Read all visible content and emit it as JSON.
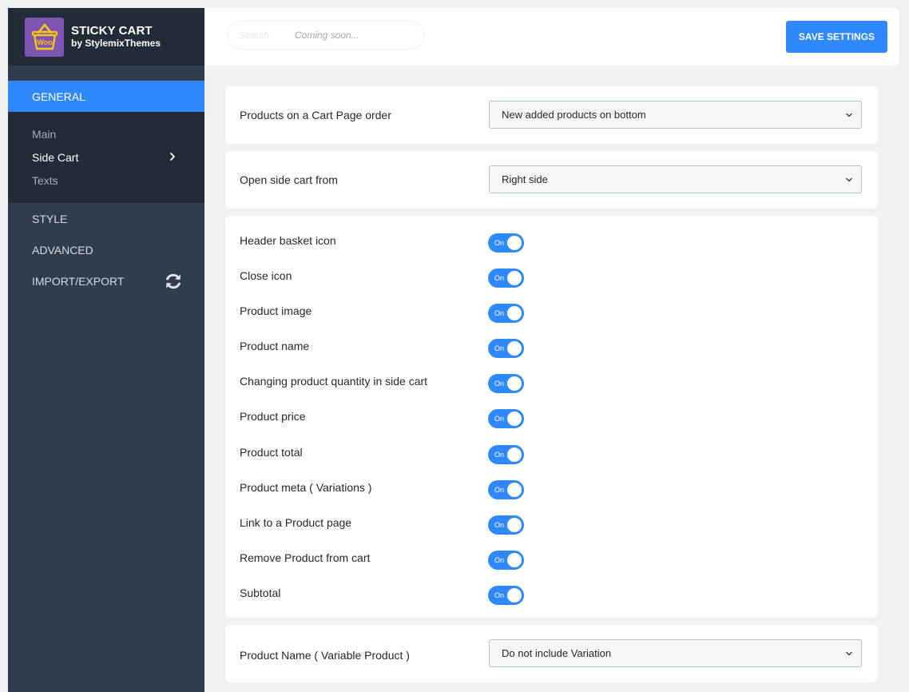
{
  "brand": {
    "title": "STICKY CART",
    "subtitle": "by StylemixThemes",
    "logo_text": "Woo",
    "logo_icon": "shopping-basket-icon",
    "logo_bg": "#7f54b3",
    "logo_color": "#f5c518"
  },
  "sidebar": {
    "general_label": "GENERAL",
    "subitems": [
      {
        "label": "Main",
        "active": false
      },
      {
        "label": "Side Cart",
        "active": true
      },
      {
        "label": "Texts",
        "active": false
      }
    ],
    "items": [
      {
        "label": "STYLE"
      },
      {
        "label": "ADVANCED"
      },
      {
        "label": "IMPORT/EXPORT",
        "icon": "refresh-icon"
      }
    ]
  },
  "header": {
    "search_placeholder": "Search",
    "search_note": "Coming soon...",
    "save_label": "SAVE SETTINGS"
  },
  "settings": {
    "cart_order": {
      "label": "Products on a Cart Page order",
      "value": "New added products on bottom"
    },
    "open_from": {
      "label": "Open side cart from",
      "value": "Right side"
    },
    "toggle_on_text": "On",
    "toggles": [
      {
        "label": "Header basket icon",
        "state": "on"
      },
      {
        "label": "Close icon",
        "state": "on"
      },
      {
        "label": "Product image",
        "state": "on"
      },
      {
        "label": "Product name",
        "state": "on"
      },
      {
        "label": "Changing product quantity in side cart",
        "state": "on"
      },
      {
        "label": "Product price",
        "state": "on"
      },
      {
        "label": "Product total",
        "state": "on"
      },
      {
        "label": "Product meta ( Variations )",
        "state": "on"
      },
      {
        "label": "Link to a Product page",
        "state": "on"
      },
      {
        "label": "Remove Product from cart",
        "state": "on"
      },
      {
        "label": "Subtotal",
        "state": "on"
      }
    ],
    "variable_name": {
      "label": "Product Name ( Variable Product )",
      "value": "Do not include Variation"
    }
  },
  "colors": {
    "accent": "#2f89fc",
    "sidebar_bg": "#2f3d4f",
    "sidebar_dark": "#212c38"
  }
}
